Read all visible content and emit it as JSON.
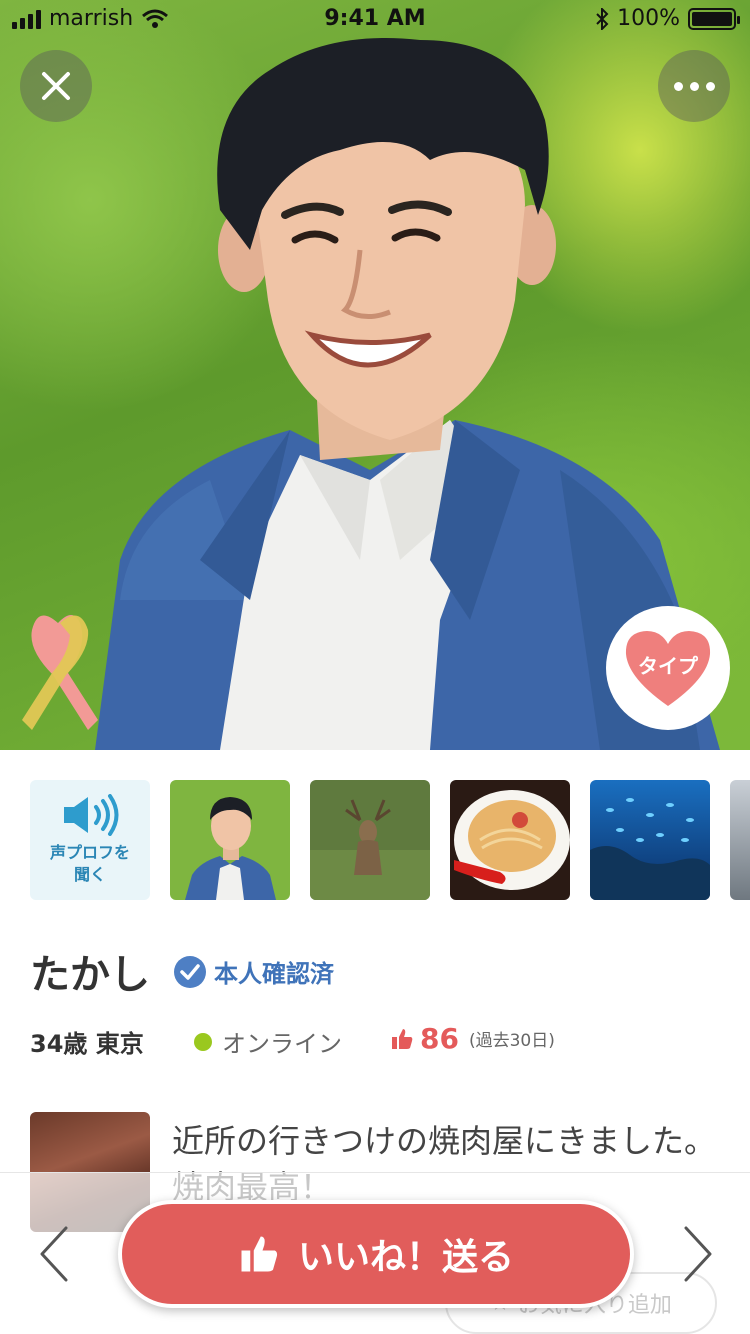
{
  "status_bar": {
    "carrier": "marrish",
    "time": "9:41 AM",
    "battery": "100%"
  },
  "profile": {
    "name": "たかし",
    "verified_label": "本人確認済",
    "age_location": "34歳 東京",
    "online_label": "オンライン",
    "likes_count": "86",
    "likes_period": "(過去30日)"
  },
  "type_button": {
    "label": "タイプ"
  },
  "voice_profile": {
    "label": "声プロフを\n聞く"
  },
  "thumbnails": [
    "profile-photo",
    "deer-photo",
    "ramen-photo",
    "ocean-fish-photo"
  ],
  "post": {
    "text": "近所の行きつけの焼肉屋にきました。焼肉最高！"
  },
  "actions": {
    "like_label": "いいね！送る",
    "favorite_label": "お気に入り追加"
  },
  "colors": {
    "accent": "#e15d5b",
    "verified": "#3f73b9",
    "online": "#9ac81f",
    "voice": "#2b86b5"
  }
}
